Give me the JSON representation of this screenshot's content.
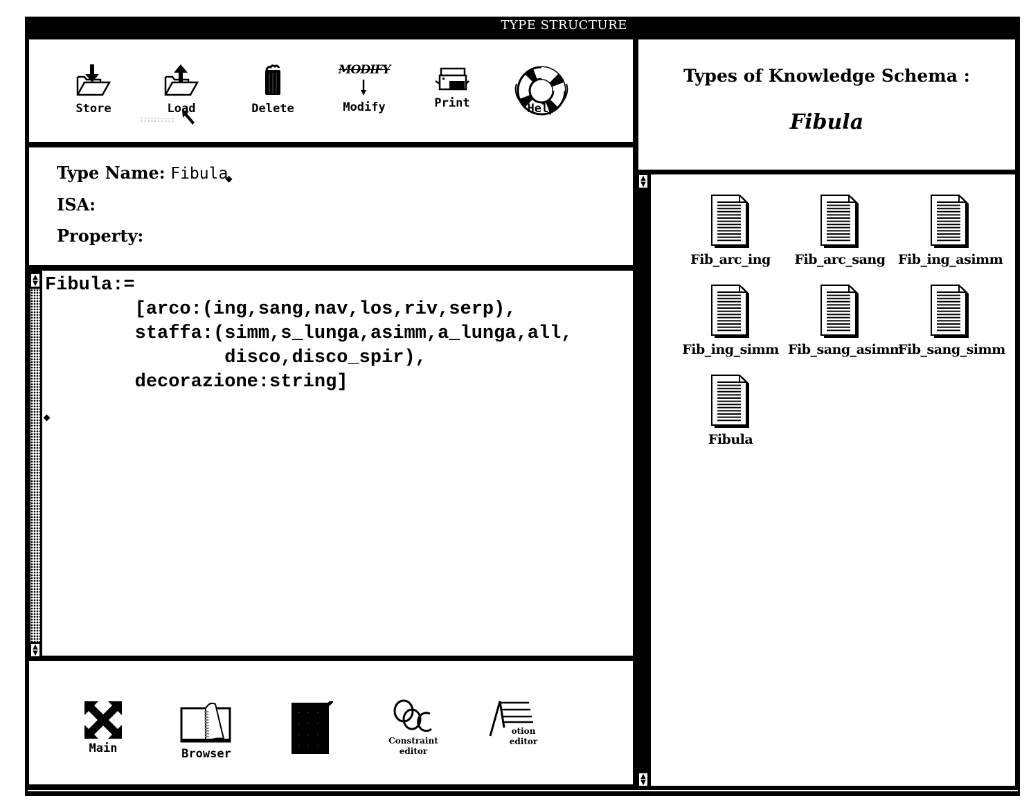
{
  "window": {
    "title": "TYPE STRUCTURE"
  },
  "toolbar": {
    "items": [
      {
        "label": "Store",
        "icon": "folder-store-icon"
      },
      {
        "label": "Load",
        "icon": "folder-load-icon"
      },
      {
        "label": "Delete",
        "icon": "trash-can-icon"
      },
      {
        "label": "Modify",
        "icon": "modify-icon",
        "icon_text": "MODIFY"
      },
      {
        "label": "Print",
        "icon": "printer-icon"
      },
      {
        "label": "Help",
        "icon": "life-ring-icon"
      }
    ]
  },
  "type_form": {
    "type_name_label": "Type Name:",
    "type_name_value": "Fibula",
    "isa_label": "ISA:",
    "isa_value": "",
    "property_label": "Property:",
    "property_value": ""
  },
  "editor": {
    "lines": [
      "Fibula:=",
      "        [arco:(ing,sang,nav,los,riv,serp),",
      "        staffa:(simm,s_lunga,asimm,a_lunga,all,",
      "                disco,disco_spir),",
      "        decorazione:string]"
    ]
  },
  "bottom_tools": {
    "items": [
      {
        "label": "Main",
        "icon": "expand-arrows-icon"
      },
      {
        "label": "Browser",
        "icon": "book-icon"
      },
      {
        "label": "",
        "icon": "notepad-icon"
      },
      {
        "label": "Constraint editor",
        "line1": "Constraint",
        "line2": "editor",
        "icon": "chain-links-icon"
      },
      {
        "label": "Action editor",
        "line1": "otion",
        "line2": "editor",
        "icon": "action-ladder-icon"
      }
    ]
  },
  "schema": {
    "heading": "Types of Knowledge Schema :",
    "name": "Fibula"
  },
  "documents": [
    {
      "label": "Fib_arc_ing"
    },
    {
      "label": "Fib_arc_sang"
    },
    {
      "label": "Fib_ing_asimm"
    },
    {
      "label": "Fib_ing_simm"
    },
    {
      "label": "Fib_sang_asimm"
    },
    {
      "label": "Fib_sang_simm"
    },
    {
      "label": "Fibula"
    }
  ]
}
